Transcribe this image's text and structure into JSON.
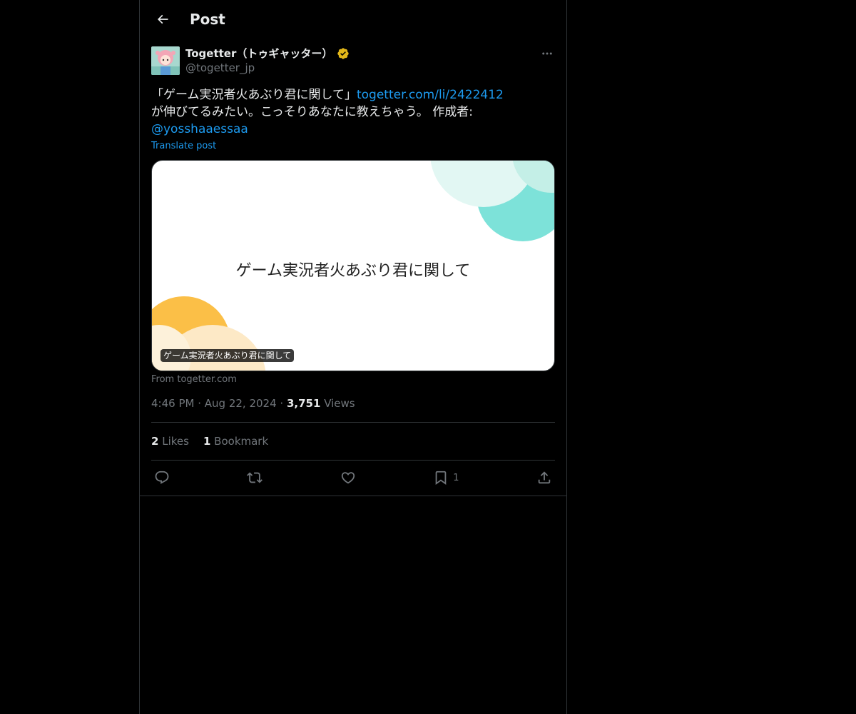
{
  "header": {
    "title": "Post"
  },
  "author": {
    "name": "Togetter（トゥギャッター）",
    "handle": "@togetter_jp",
    "verified_color": "#e2b719"
  },
  "post": {
    "text_before_link": "「ゲーム実況者火あぶり君に関して」",
    "link": "togetter.com/li/2422412",
    "text_after_link": "が伸びてるみたい。こっそりあなたに教えちゃう。 作成者:",
    "mention": "@yosshaaessaa",
    "translate": "Translate post"
  },
  "card": {
    "title": "ゲーム実況者火あぶり君に関して",
    "caption": "ゲーム実況者火あぶり君に関して",
    "from": "From togetter.com"
  },
  "meta": {
    "time": "4:46 PM",
    "date": "Aug 22, 2024",
    "views_count": "3,751",
    "views_label": "Views"
  },
  "counts": {
    "likes_count": "2",
    "likes_label": "Likes",
    "bookmarks_count": "1",
    "bookmarks_label": "Bookmark"
  },
  "actions": {
    "bookmark_count": "1"
  },
  "colors": {
    "accent": "#1d9bf0",
    "muted": "#71767b",
    "border": "#2f3336"
  }
}
